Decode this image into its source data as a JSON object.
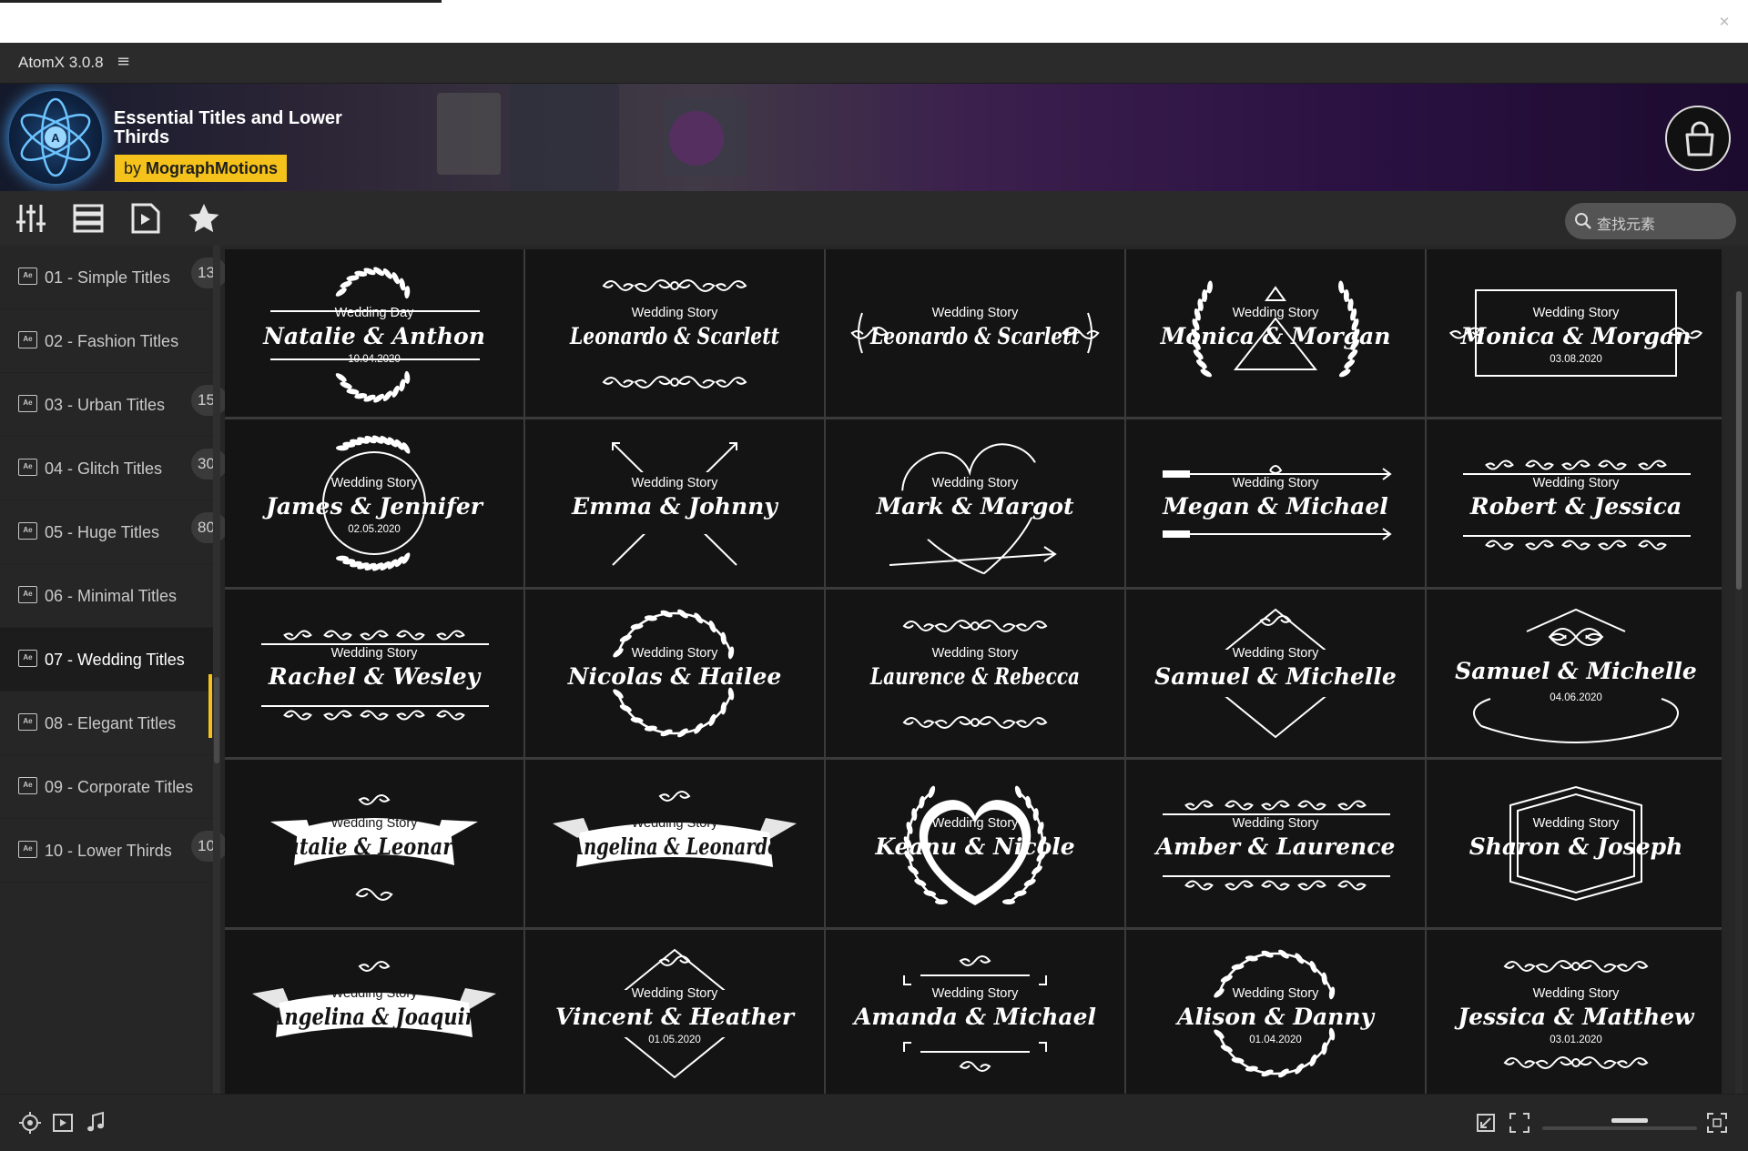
{
  "app": {
    "title": "AtomX 3.0.8",
    "menu_icon": "hamburger-icon",
    "close_icon": "close-icon"
  },
  "banner": {
    "title": "Essential Titles and Lower Thirds",
    "by_prefix": "by",
    "by_author": "MographMotions",
    "accent": "#f4c21b"
  },
  "toolbar": {
    "buttons": [
      "sliders-icon",
      "list-icon",
      "preview-icon",
      "star-icon"
    ]
  },
  "search": {
    "placeholder": "查找元素"
  },
  "sidebar": {
    "categories": [
      {
        "label": "01 - Simple Titles",
        "count": "13"
      },
      {
        "label": "02 - Fashion Titles",
        "count": ""
      },
      {
        "label": "03 - Urban Titles",
        "count": "15"
      },
      {
        "label": "04 - Glitch Titles",
        "count": "30"
      },
      {
        "label": "05 - Huge Titles",
        "count": "80"
      },
      {
        "label": "06 - Minimal Titles",
        "count": ""
      },
      {
        "label": "07 - Wedding Titles",
        "count": ""
      },
      {
        "label": "08 - Elegant Titles",
        "count": ""
      },
      {
        "label": "09 - Corporate Titles",
        "count": ""
      },
      {
        "label": "10 - Lower Thirds",
        "count": "10"
      }
    ],
    "selected": "07 - Wedding Titles"
  },
  "grid": {
    "items": [
      {
        "kicker": "Wedding Day",
        "names": "Natalie & Anthon",
        "date": "10.04.2020",
        "style": "laurel-lines"
      },
      {
        "kicker": "Wedding Story",
        "names": "Leonardo & Scarlett",
        "date": "",
        "style": "flourish"
      },
      {
        "kicker": "Wedding Story",
        "names": "Leonardo & Scarlett",
        "date": "",
        "style": "side-curls"
      },
      {
        "kicker": "Wedding Story",
        "names": "Monica & Morgan",
        "date": "",
        "style": "laurel-triangle"
      },
      {
        "kicker": "Wedding Story",
        "names": "Monica & Morgan",
        "date": "03.08.2020",
        "style": "frame"
      },
      {
        "kicker": "Wedding Story",
        "names": "James & Jennifer",
        "date": "02.05.2020",
        "style": "circle"
      },
      {
        "kicker": "Wedding Story",
        "names": "Emma & Johnny",
        "date": "",
        "style": "arrows"
      },
      {
        "kicker": "Wedding Story",
        "names": "Mark & Margot",
        "date": "",
        "style": "heart-arrow"
      },
      {
        "kicker": "Wedding Story",
        "names": "Megan & Michael",
        "date": "",
        "style": "arrow-lines"
      },
      {
        "kicker": "Wedding Story",
        "names": "Robert & Jessica",
        "date": "",
        "style": "ornament-bars"
      },
      {
        "kicker": "Wedding Story",
        "names": "Rachel & Wesley",
        "date": "",
        "style": "ornament-bars"
      },
      {
        "kicker": "Wedding Story",
        "names": "Nicolas & Hailee",
        "date": "",
        "style": "laurel-circle"
      },
      {
        "kicker": "Wedding Story",
        "names": "Laurence & Rebecca",
        "date": "",
        "style": "flourish"
      },
      {
        "kicker": "Wedding Story",
        "names": "Samuel & Michelle",
        "date": "",
        "style": "diamond"
      },
      {
        "kicker": "",
        "names": "Samuel & Michelle",
        "date": "04.06.2020",
        "style": "swirl"
      },
      {
        "kicker": "Wedding Story",
        "names": "Natalie & Leonardo",
        "date": "",
        "style": "ribbon"
      },
      {
        "kicker": "Wedding Story",
        "names": "Angelina & Leonardo",
        "date": "",
        "style": "ribbon-filled"
      },
      {
        "kicker": "Wedding Story",
        "names": "Keanu & Nicole",
        "date": "",
        "style": "heart-laurel"
      },
      {
        "kicker": "Wedding Story",
        "names": "Amber & Laurence",
        "date": "",
        "style": "ornament-bars"
      },
      {
        "kicker": "Wedding Story",
        "names": "Sharon & Joseph",
        "date": "",
        "style": "hexagon"
      },
      {
        "kicker": "Wedding Story",
        "names": "Angelina & Joaquin",
        "date": "",
        "style": "ribbon-filled"
      },
      {
        "kicker": "Wedding Story",
        "names": "Vincent & Heather",
        "date": "01.05.2020",
        "style": "diamond"
      },
      {
        "kicker": "Wedding Story",
        "names": "Amanda & Michael",
        "date": "",
        "style": "bracket"
      },
      {
        "kicker": "Wedding Story",
        "names": "Alison & Danny",
        "date": "01.04.2020",
        "style": "laurel-circle"
      },
      {
        "kicker": "Wedding Story",
        "names": "Jessica & Matthew",
        "date": "03.01.2020",
        "style": "flourish"
      }
    ]
  },
  "statusbar": {
    "left_icons": [
      "target-icon",
      "video-icon",
      "music-icon"
    ],
    "right_icons": [
      "shrink-icon",
      "grid-size-icon",
      "expand-icon"
    ],
    "zoom_level": 0.5
  }
}
